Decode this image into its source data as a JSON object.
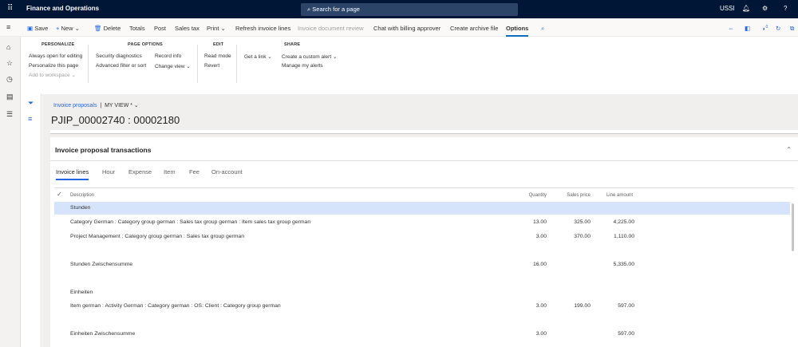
{
  "topbar": {
    "app_title": "Finance and Operations",
    "search_placeholder": "Search for a page",
    "company": "USSI"
  },
  "actions": {
    "save": "Save",
    "new": "New",
    "delete": "Delete",
    "totals": "Totals",
    "post": "Post",
    "sales_tax": "Sales tax",
    "print": "Print",
    "refresh": "Refresh invoice lines",
    "doc_review": "Invoice document review",
    "chat": "Chat with billing approver",
    "archive": "Create archive file",
    "options": "Options",
    "notification_count": "0"
  },
  "ribbon": {
    "personalize": {
      "header": "PERSONALIZE",
      "items": [
        "Always open for editing",
        "Personalize this page",
        "Add to workspace"
      ]
    },
    "page_options": {
      "header": "PAGE OPTIONS",
      "items": [
        "Security diagnostics",
        "Advanced filter or sort",
        "Record info",
        "Change view"
      ]
    },
    "edit": {
      "header": "EDIT",
      "items": [
        "Read mode",
        "Revert"
      ]
    },
    "share": {
      "header": "SHARE",
      "items": [
        "Get a link",
        "Create a custom alert",
        "Manage my alerts"
      ]
    }
  },
  "page": {
    "breadcrumb": "Invoice proposals",
    "view": "MY VIEW *",
    "title": "PJIP_00002740 : 00002180"
  },
  "section": {
    "title": "Invoice proposal transactions",
    "tabs": [
      "Invoice lines",
      "Hour",
      "Expense",
      "Item",
      "Fee",
      "On-account"
    ],
    "columns": [
      "Description",
      "Quantity",
      "Sales price",
      "Line amount"
    ],
    "rows": [
      {
        "description": "Stunden",
        "quantity": "",
        "price": "",
        "amount": ""
      },
      {
        "description": "Category German : Category group german : Sales tax group german : Item sales tax group german",
        "quantity": "13.00",
        "price": "325.00",
        "amount": "4,225.00"
      },
      {
        "description": "Project Management : Category group german : Sales tax group german",
        "quantity": "3.00",
        "price": "370.00",
        "amount": "1,110.00"
      },
      {
        "description": "Stunden Zwischensumme",
        "quantity": "16.00",
        "price": "",
        "amount": "5,335.00"
      },
      {
        "description": "Einheiten",
        "quantity": "",
        "price": "",
        "amount": ""
      },
      {
        "description": "Item german : Activity German : Category german : OS: Client : Category group german",
        "quantity": "3.00",
        "price": "199.00",
        "amount": "597.00"
      },
      {
        "description": "Einheiten Zwischensumme",
        "quantity": "3.00",
        "price": "",
        "amount": "597.00"
      }
    ]
  }
}
